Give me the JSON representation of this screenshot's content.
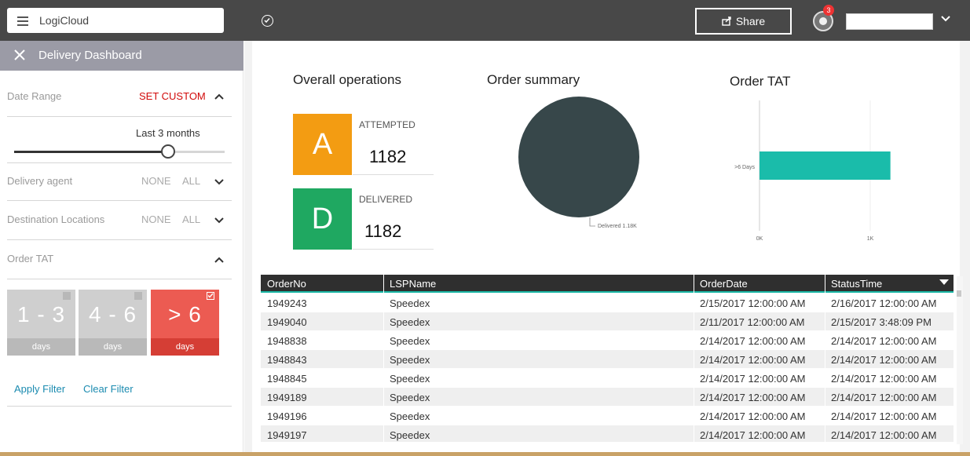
{
  "topbar": {
    "app_name": "LogiCloud",
    "share_label": "Share",
    "notification_count": "3"
  },
  "sidebar": {
    "title": "Delivery Dashboard",
    "date_range": {
      "label": "Date Range",
      "action": "SET CUSTOM",
      "slider_value": "Last 3 months",
      "slider_level": 0.73
    },
    "delivery_agent": {
      "label": "Delivery agent",
      "none": "NONE",
      "all": "ALL"
    },
    "destination_locations": {
      "label": "Destination Locations",
      "none": "NONE",
      "all": "ALL"
    },
    "order_tat": {
      "label": "Order TAT",
      "tiles": [
        {
          "value": "1 - 3",
          "unit": "days",
          "selected": false
        },
        {
          "value": "4 - 6",
          "unit": "days",
          "selected": false
        },
        {
          "value": "> 6",
          "unit": "days",
          "selected": true
        }
      ]
    },
    "apply_filter": "Apply Filter",
    "clear_filter": "Clear Filter"
  },
  "overall_operations": {
    "title": "Overall operations",
    "cards": [
      {
        "letter": "A",
        "label": "ATTEMPTED",
        "value": "1182",
        "color": "#f39c12"
      },
      {
        "letter": "D",
        "label": "DELIVERED",
        "value": "1182",
        "color": "#1fa861"
      }
    ]
  },
  "order_summary": {
    "title": "Order summary",
    "slice_label": "Delivered 1.18K"
  },
  "order_tat_chart": {
    "title": "Order TAT"
  },
  "chart_data": [
    {
      "type": "pie",
      "title": "Order summary",
      "labels": [
        "Delivered"
      ],
      "values": [
        1182
      ],
      "colors": [
        "#37474a"
      ]
    },
    {
      "type": "bar",
      "orientation": "horizontal",
      "title": "Order TAT",
      "categories": [
        ">6 Days"
      ],
      "values": [
        1182
      ],
      "xlim": [
        0,
        1000
      ],
      "xticks": [
        "0K",
        "1K"
      ],
      "colors": [
        "#1abcaa"
      ]
    }
  ],
  "table": {
    "columns": [
      "OrderNo",
      "LSPName",
      "OrderDate",
      "StatusTime"
    ],
    "rows": [
      [
        "1949243",
        "Speedex",
        "2/15/2017 12:00:00 AM",
        "2/16/2017 12:00:00 AM"
      ],
      [
        "1949040",
        "Speedex",
        "2/11/2017 12:00:00 AM",
        "2/15/2017 3:48:09 PM"
      ],
      [
        "1948838",
        "Speedex",
        "2/14/2017 12:00:00 AM",
        "2/14/2017 12:00:00 AM"
      ],
      [
        "1948843",
        "Speedex",
        "2/14/2017 12:00:00 AM",
        "2/14/2017 12:00:00 AM"
      ],
      [
        "1948845",
        "Speedex",
        "2/14/2017 12:00:00 AM",
        "2/14/2017 12:00:00 AM"
      ],
      [
        "1949189",
        "Speedex",
        "2/14/2017 12:00:00 AM",
        "2/14/2017 12:00:00 AM"
      ],
      [
        "1949196",
        "Speedex",
        "2/14/2017 12:00:00 AM",
        "2/14/2017 12:00:00 AM"
      ],
      [
        "1949197",
        "Speedex",
        "2/14/2017 12:00:00 AM",
        "2/14/2017 12:00:00 AM"
      ]
    ]
  }
}
